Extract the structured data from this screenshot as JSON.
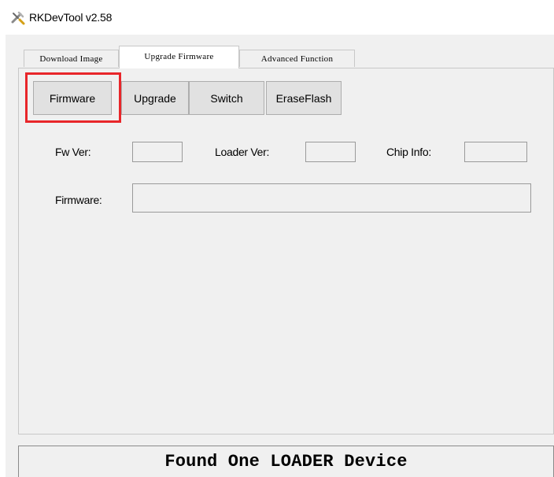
{
  "window": {
    "title": "RKDevTool v2.58",
    "icon": "rk-tool-icon"
  },
  "tabs": [
    {
      "label": "Download Image",
      "active": false
    },
    {
      "label": "Upgrade Firmware",
      "active": true
    },
    {
      "label": "Advanced Function",
      "active": false
    }
  ],
  "buttons": {
    "firmware": "Firmware",
    "upgrade": "Upgrade",
    "switch": "Switch",
    "erase_flash": "EraseFlash"
  },
  "fields": {
    "fw_ver_label": "Fw Ver:",
    "fw_ver_value": "",
    "loader_ver_label": "Loader Ver:",
    "loader_ver_value": "",
    "chip_info_label": "Chip Info:",
    "chip_info_value": "",
    "firmware_label": "Firmware:",
    "firmware_value": ""
  },
  "status": {
    "message": "Found One LOADER Device"
  },
  "colors": {
    "highlight": "#e8262a",
    "window_bg": "#f0f0f0",
    "button_bg": "#e1e1e1"
  }
}
